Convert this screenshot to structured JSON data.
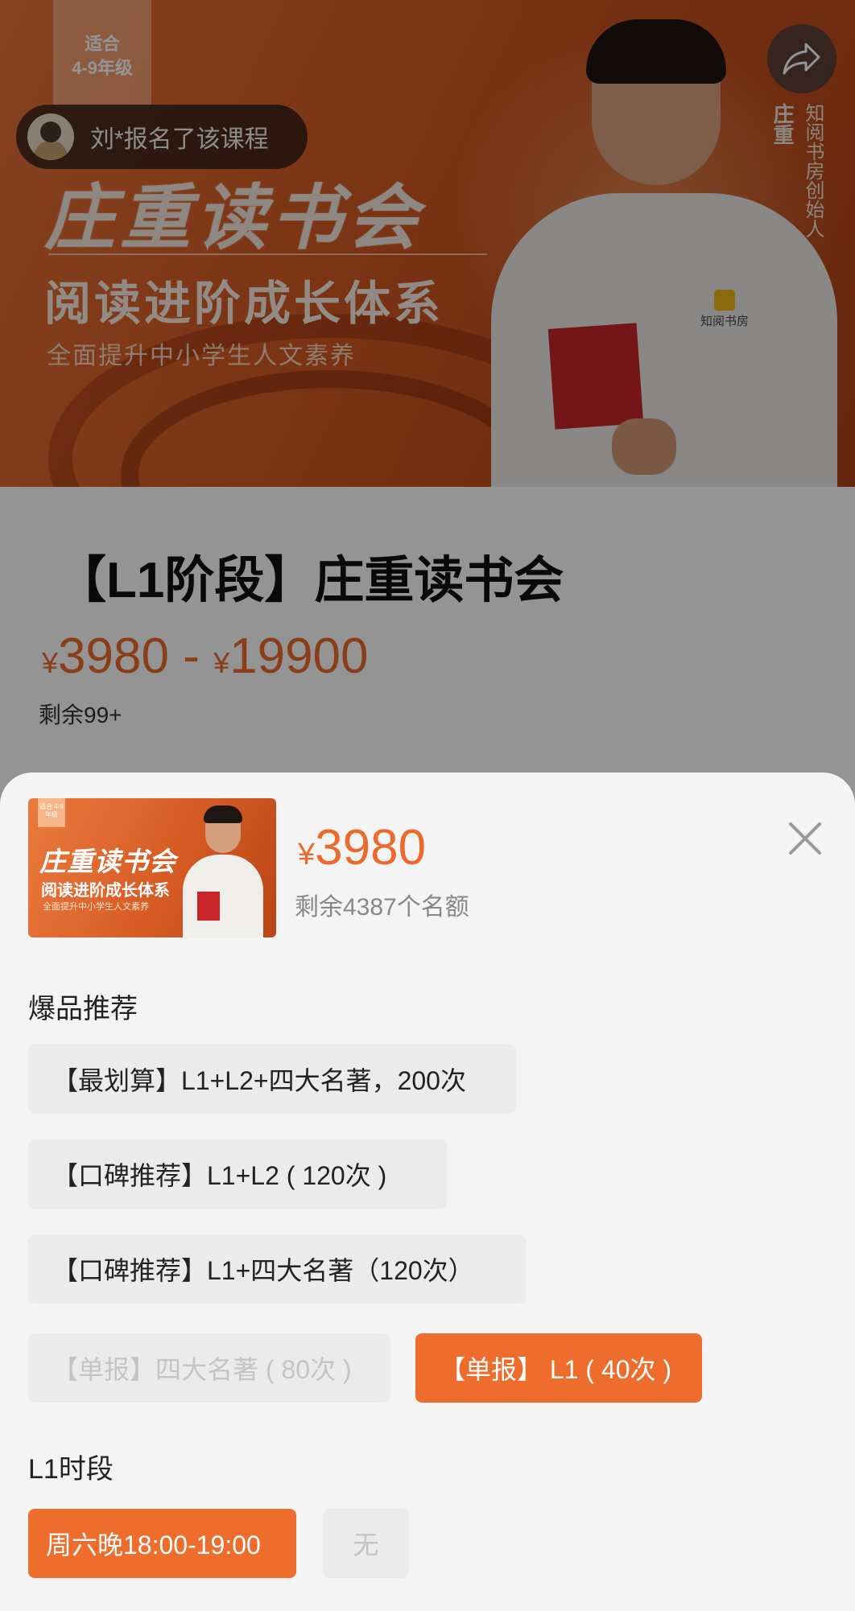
{
  "banner": {
    "age_tag": "适合\n4-9年级",
    "enroll_notice": "刘*报名了该课程",
    "title": "庄重读书会",
    "subtitle": "阅读进阶成长体系",
    "tagline": "全面提升中小学生人文素养",
    "person_name": "庄重",
    "person_role": "知阅书房创始人",
    "badge_text": "知阅书房"
  },
  "product": {
    "title": "【L1阶段】庄重读书会",
    "currency": "¥",
    "price_low": "3980",
    "price_sep": " - ",
    "price_high": "19900",
    "remaining": "剩余99+"
  },
  "sheet": {
    "thumb_title": "庄重读书会",
    "thumb_subtitle": "阅读进阶成长体系",
    "thumb_tagline": "全面提升中小学生人文素养",
    "thumb_age": "适合 4-9年级",
    "currency": "¥",
    "price": "3980",
    "remaining": "剩余4387个名额",
    "group1_label": "爆品推荐",
    "options": [
      {
        "label": "【最划算】L1+L2+四大名著，200次",
        "state": "normal"
      },
      {
        "label": "【口碑推荐】L1+L2 ( 120次 )",
        "state": "normal"
      },
      {
        "label": "【口碑推荐】L1+四大名著（120次）",
        "state": "normal"
      },
      {
        "label": "【单报】四大名著 ( 80次 )",
        "state": "disabled"
      },
      {
        "label": "【单报】 L1 ( 40次 )",
        "state": "selected"
      }
    ],
    "group2_label": "L1时段",
    "time_options": [
      {
        "label": "周六晚18:00-19:00",
        "state": "selected"
      },
      {
        "label": "无",
        "state": "disabled"
      }
    ]
  },
  "colors": {
    "accent": "#ee6d2d",
    "price": "#ec6a2c",
    "sheet_bg": "#f4f4f5",
    "option_bg": "#ebebeb"
  },
  "icons": {
    "share": "share-icon",
    "close": "close-icon"
  }
}
